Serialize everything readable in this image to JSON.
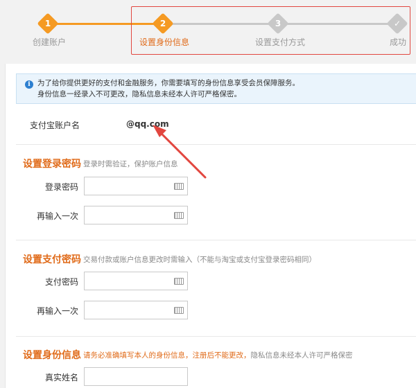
{
  "steps": [
    {
      "num": "1",
      "label": "创建账户",
      "state": "done"
    },
    {
      "num": "2",
      "label": "设置身份信息",
      "state": "current"
    },
    {
      "num": "3",
      "label": "设置支付方式",
      "state": "todo"
    },
    {
      "num": "✓",
      "label": "成功",
      "state": "todo"
    }
  ],
  "colors": {
    "accent": "#f59a23",
    "current_label": "#e06b1a",
    "inactive": "#bbbbbb",
    "highlight": "#e2463f",
    "section_title": "#e06b1a"
  },
  "notice": {
    "icon": "info-icon",
    "line1": "为了给你提供更好的支付和金融服务，你需要填写的身份信息享受会员保障服务。",
    "line2": "身份信息一经录入不可更改，隐私信息未经本人许可严格保密。"
  },
  "account": {
    "label": "支付宝账户名",
    "value": "@qq.com"
  },
  "login_pwd": {
    "title": "设置登录密码",
    "desc": "登录时需验证，保护账户信息",
    "field1": "登录密码",
    "field2": "再输入一次"
  },
  "pay_pwd": {
    "title": "设置支付密码",
    "desc": "交易付款或账户信息更改时需输入（不能与淘宝或支付宝登录密码相同）",
    "field1": "支付密码",
    "field2": "再输入一次"
  },
  "identity": {
    "title": "设置身份信息",
    "desc_warn": "请务必准确填写本人的身份信息，注册后不能更改，",
    "desc_rest": "隐私信息未经本人许可严格保密",
    "field1": "真实姓名"
  },
  "icons": {
    "keyboard": "keyboard-icon",
    "check": "check-icon"
  }
}
